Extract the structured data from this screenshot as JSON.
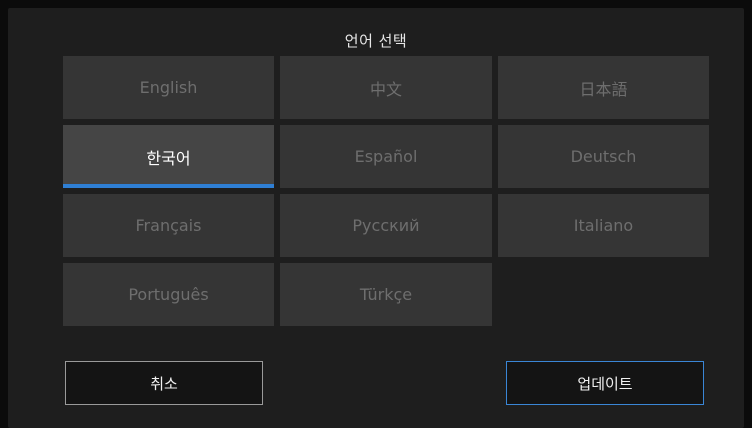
{
  "dialog": {
    "title": "언어 선택",
    "languages": [
      {
        "label": "English",
        "selected": false
      },
      {
        "label": "中文",
        "selected": false
      },
      {
        "label": "日本語",
        "selected": false
      },
      {
        "label": "한국어",
        "selected": true
      },
      {
        "label": "Español",
        "selected": false
      },
      {
        "label": "Deutsch",
        "selected": false
      },
      {
        "label": "Français",
        "selected": false
      },
      {
        "label": "Русский",
        "selected": false
      },
      {
        "label": "Italiano",
        "selected": false
      },
      {
        "label": "Português",
        "selected": false
      },
      {
        "label": "Türkçe",
        "selected": false
      }
    ],
    "cancel_label": "취소",
    "update_label": "업데이트"
  },
  "colors": {
    "accent": "#2f7fd4",
    "panel_bg": "#1e1e1e",
    "button_bg": "#353535",
    "selected_bg": "#454545"
  }
}
